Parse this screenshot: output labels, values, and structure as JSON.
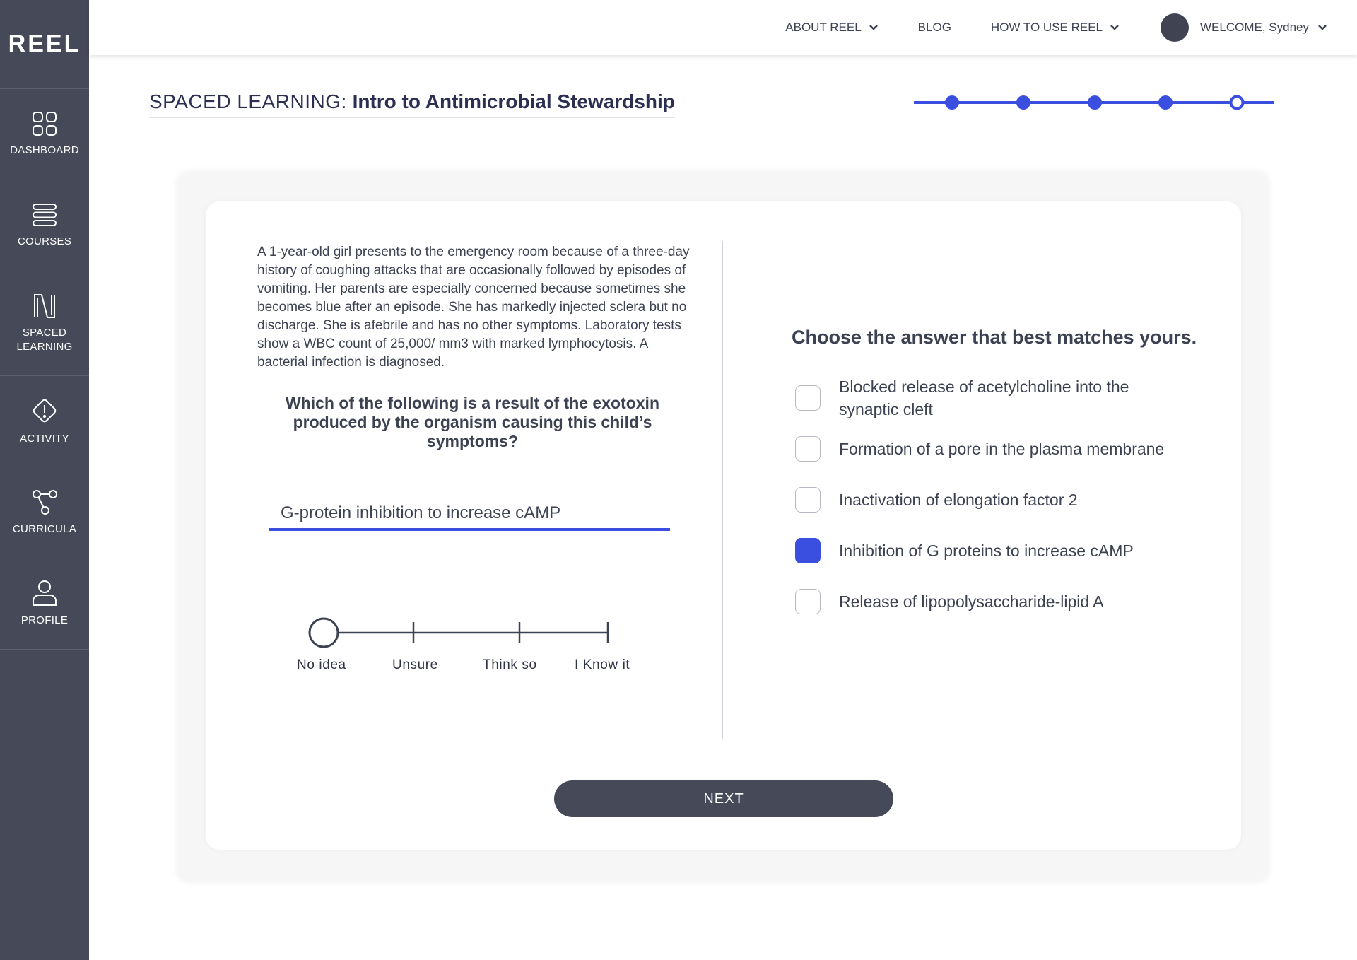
{
  "app": {
    "logo": "REEL"
  },
  "sidebar": {
    "items": [
      {
        "label": "DASHBOARD",
        "icon": "grid-icon"
      },
      {
        "label": "COURSES",
        "icon": "list-icon"
      },
      {
        "label": "SPACED\nLEARNING",
        "icon": "spaced-learning-icon"
      },
      {
        "label": "ACTIVITY",
        "icon": "alert-diamond-icon"
      },
      {
        "label": "CURRICULA",
        "icon": "nodes-icon"
      },
      {
        "label": "PROFILE",
        "icon": "person-icon"
      }
    ]
  },
  "topnav": {
    "about": "ABOUT REEL",
    "blog": "BLOG",
    "howto": "HOW TO USE REEL",
    "welcome": "WELCOME, Sydney"
  },
  "header": {
    "prefix": "SPACED LEARNING:",
    "course": "Intro to Antimicrobial Stewardship",
    "progress": {
      "total_steps": 5,
      "current_step": 5,
      "completed_steps": 4
    }
  },
  "question": {
    "vignette": "A 1-year-old girl presents to the emergency room because of a three-day history of coughing attacks that are occasionally followed by episodes of vomiting. Her parents are especially concerned because sometimes she becomes blue after an episode. She has markedly injected sclera but no discharge. She is afebrile and has no other symptoms. Laboratory tests show a WBC count of 25,000/ mm3 with marked lymphocytosis. A bacterial infection is diagnosed.",
    "stem": "Which of the following is a result of the exotoxin produced by the organism causing this child’s symptoms?",
    "typed_answer": "G-protein inhibition to increase cAMP"
  },
  "confidence": {
    "levels": [
      "No idea",
      "Unsure",
      "Think so",
      "I Know it"
    ],
    "selected_index": 0
  },
  "choices": {
    "prompt": "Choose the answer that best matches yours.",
    "options": [
      {
        "text": "Blocked release of acetylcholine into the synaptic cleft",
        "checked": false
      },
      {
        "text": "Formation of a pore in the plasma membrane",
        "checked": false
      },
      {
        "text": "Inactivation of elongation factor 2",
        "checked": false
      },
      {
        "text": "Inhibition of G proteins to increase cAMP",
        "checked": true
      },
      {
        "text": "Release of lipopolysaccharide-lipid A",
        "checked": false
      }
    ]
  },
  "actions": {
    "next": "NEXT"
  },
  "colors": {
    "accent": "#3a4fe0",
    "sidebar": "#464a58",
    "text": "#3d4252"
  }
}
